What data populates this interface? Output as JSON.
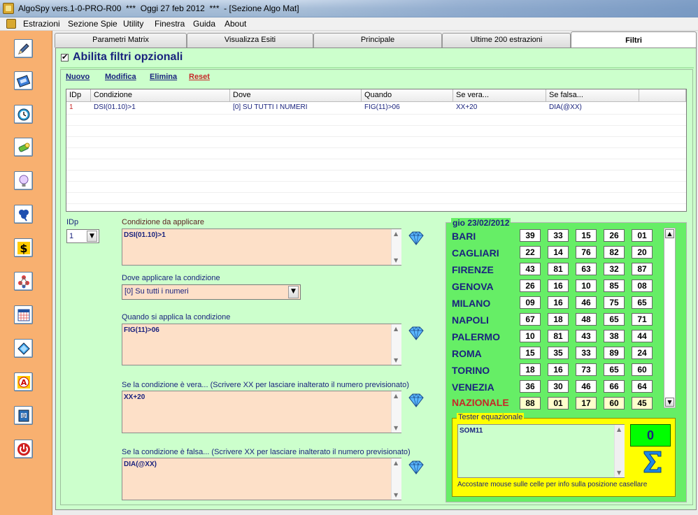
{
  "window": {
    "title": "AlgoSpy vers.1-0-PRO-R00  ***  Oggi 27 feb 2012  ***  - [Sezione Algo Mat]"
  },
  "menu": [
    "Estrazioni",
    "Sezione Spie",
    "Utility",
    "Finestra",
    "Guida",
    "About"
  ],
  "sidebar": {
    "icons": [
      "pencil-icon",
      "book-icon",
      "clock-icon",
      "torch-icon",
      "lightbulb-icon",
      "clover-icon",
      "dollar-icon",
      "network-icon",
      "calendar-icon",
      "diamond-icon",
      "letter-a-icon",
      "mail-book-icon",
      "power-icon"
    ]
  },
  "tabs": [
    "Parametri Matrix",
    "Visualizza Esiti",
    "Principale",
    "Ultime 200 estrazioni",
    "Filtri"
  ],
  "active_tab": "Filtri",
  "header": {
    "checkbox_checked": true,
    "label": "Abilita filtri opzionali"
  },
  "actions": {
    "nuovo": "Nuovo",
    "modifica": "Modifica",
    "elimina": "Elimina",
    "reset": "Reset"
  },
  "grid": {
    "columns": [
      "IDp",
      "Condizione",
      "Dove",
      "Quando",
      "Se vera...",
      "Se falsa..."
    ],
    "rows": [
      {
        "idp": "1",
        "condizione": "DSI(01.10)>1",
        "dove": "[0] SU TUTTI I NUMERI",
        "quando": "FIG(11)>06",
        "se_vera": "XX+20",
        "se_falsa": "DIA(@XX)"
      }
    ]
  },
  "form": {
    "idp_label": "IDp",
    "idp_value": "1",
    "cond_label": "Condizione da applicare",
    "cond_value": "DSI(01.10)>1",
    "dove_label": "Dove applicare la condizione",
    "dove_value": "[0] Su tutti i numeri",
    "quando_label": "Quando si applica la condizione",
    "quando_value": "FIG(11)>06",
    "vera_label": "Se la condizione è vera... (Scrivere XX per lasciare inalterato il numero previsionato)",
    "vera_value": "XX+20",
    "falsa_label": "Se la condizione è falsa...  (Scrivere XX per lasciare inalterato il numero previsionato)",
    "falsa_value": "DIA(@XX)"
  },
  "extraction": {
    "date": "gio 23/02/2012",
    "rows": [
      {
        "city": "BARI",
        "numbers": [
          "39",
          "33",
          "15",
          "26",
          "01"
        ]
      },
      {
        "city": "CAGLIARI",
        "numbers": [
          "22",
          "14",
          "76",
          "82",
          "20"
        ]
      },
      {
        "city": "FIRENZE",
        "numbers": [
          "43",
          "81",
          "63",
          "32",
          "87"
        ]
      },
      {
        "city": "GENOVA",
        "numbers": [
          "26",
          "16",
          "10",
          "85",
          "08"
        ]
      },
      {
        "city": "MILANO",
        "numbers": [
          "09",
          "16",
          "46",
          "75",
          "65"
        ]
      },
      {
        "city": "NAPOLI",
        "numbers": [
          "67",
          "18",
          "48",
          "65",
          "71"
        ]
      },
      {
        "city": "PALERMO",
        "numbers": [
          "10",
          "81",
          "43",
          "38",
          "44"
        ]
      },
      {
        "city": "ROMA",
        "numbers": [
          "15",
          "35",
          "33",
          "89",
          "24"
        ]
      },
      {
        "city": "TORINO",
        "numbers": [
          "18",
          "16",
          "73",
          "65",
          "60"
        ]
      },
      {
        "city": "VENEZIA",
        "numbers": [
          "36",
          "30",
          "46",
          "66",
          "64"
        ]
      },
      {
        "city": "NAZIONALE",
        "numbers": [
          "88",
          "01",
          "17",
          "60",
          "45"
        ]
      }
    ]
  },
  "tester": {
    "label": "Tester equazionale",
    "value": "SOM11",
    "result": "0",
    "hint": "Accostare mouse sulle celle per info sulla posizione casellare"
  }
}
